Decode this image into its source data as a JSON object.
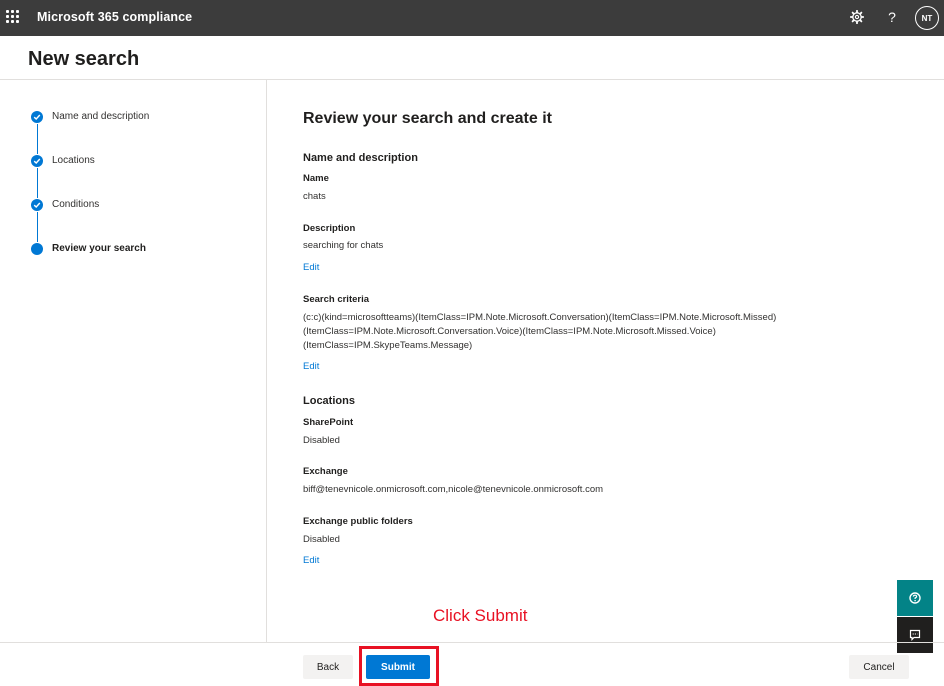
{
  "topbar": {
    "app_title": "Microsoft 365 compliance",
    "avatar_initials": "NT",
    "help_glyph": "?"
  },
  "page": {
    "title": "New search"
  },
  "steps": [
    {
      "label": "Name and description",
      "status": "completed"
    },
    {
      "label": "Locations",
      "status": "completed"
    },
    {
      "label": "Conditions",
      "status": "completed"
    },
    {
      "label": "Review your search",
      "status": "current"
    }
  ],
  "review": {
    "heading": "Review your search and create it",
    "name_section": {
      "title": "Name and description",
      "name_label": "Name",
      "name_value": "chats",
      "description_label": "Description",
      "description_value": "searching for chats",
      "edit_label": "Edit"
    },
    "criteria_section": {
      "title": "Search criteria",
      "lines": [
        "(c:c)(kind=microsoftteams)(ItemClass=IPM.Note.Microsoft.Conversation)(ItemClass=IPM.Note.Microsoft.Missed)",
        "(ItemClass=IPM.Note.Microsoft.Conversation.Voice)(ItemClass=IPM.Note.Microsoft.Missed.Voice)",
        "(ItemClass=IPM.SkypeTeams.Message)"
      ],
      "edit_label": "Edit"
    },
    "locations_section": {
      "title": "Locations",
      "sharepoint_label": "SharePoint",
      "sharepoint_value": "Disabled",
      "exchange_label": "Exchange",
      "exchange_value": "biff@tenevnicole.onmicrosoft.com,nicole@tenevnicole.onmicrosoft.com",
      "public_folders_label": "Exchange public folders",
      "public_folders_value": "Disabled",
      "edit_label": "Edit"
    }
  },
  "footer": {
    "back_label": "Back",
    "submit_label": "Submit",
    "cancel_label": "Cancel"
  },
  "annotation": {
    "text": "Click Submit"
  },
  "colors": {
    "accent": "#0078d4",
    "topbar": "#3c3c3c",
    "annotation": "#e81123",
    "help_button": "#038387"
  },
  "icons": [
    "waffle-icon",
    "gear-icon",
    "help-icon",
    "checkmark-icon",
    "question-circle-icon",
    "feedback-icon"
  ]
}
